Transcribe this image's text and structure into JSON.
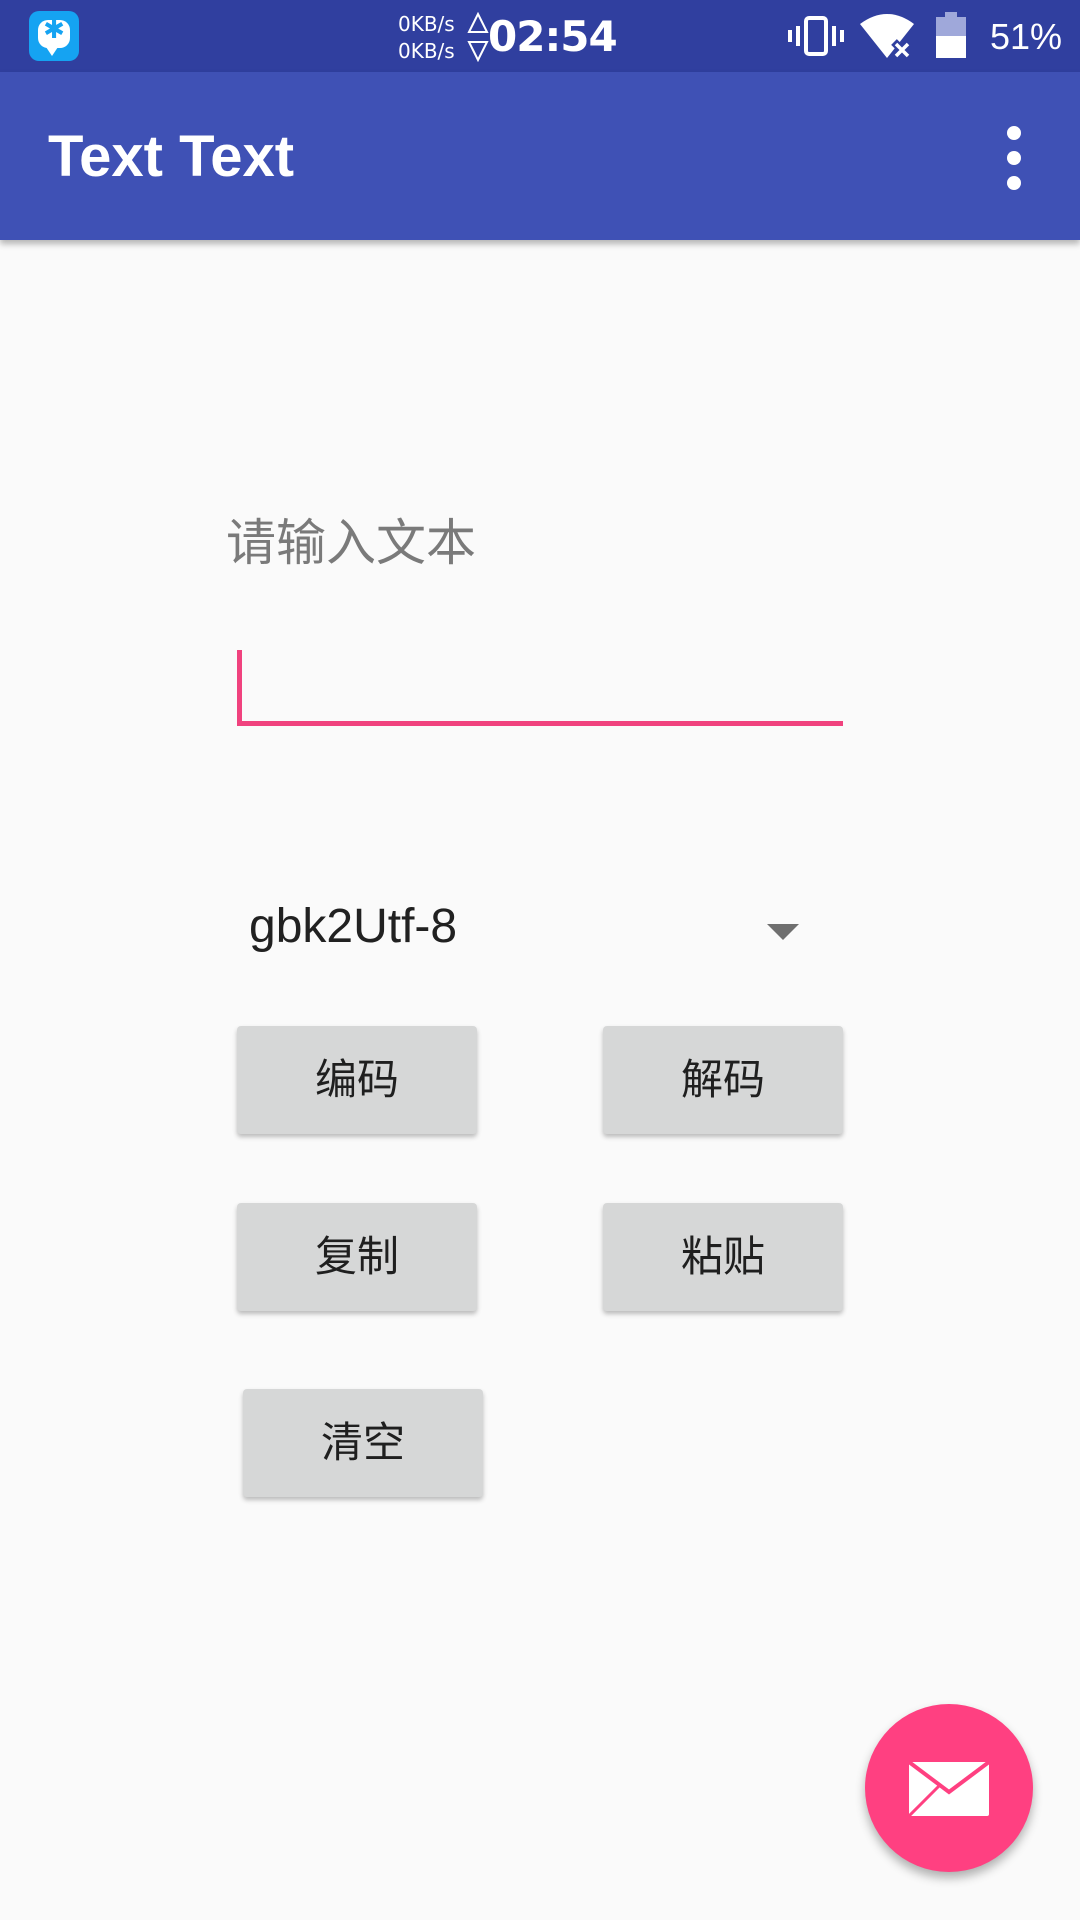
{
  "status_bar": {
    "net_up": "0KB/s",
    "net_down": "0KB/s",
    "time": "02:54",
    "battery": "51%",
    "icons": [
      "app-notification-icon",
      "vibrate-icon",
      "wifi-icon",
      "battery-icon"
    ],
    "background_color": "#303f9f"
  },
  "app_bar": {
    "title": "Text Text",
    "menu_icon": "overflow-menu-icon",
    "background_color": "#3f51b5"
  },
  "form": {
    "input_label": "请输入文本",
    "input_value": "",
    "accent_color": "#f0427e"
  },
  "spinner": {
    "selected": "gbk2Utf-8"
  },
  "buttons": {
    "encode": "编码",
    "decode": "解码",
    "copy": "复制",
    "paste": "粘贴",
    "clear": "清空"
  },
  "fab": {
    "icon": "mail-icon",
    "color": "#ff4081"
  }
}
